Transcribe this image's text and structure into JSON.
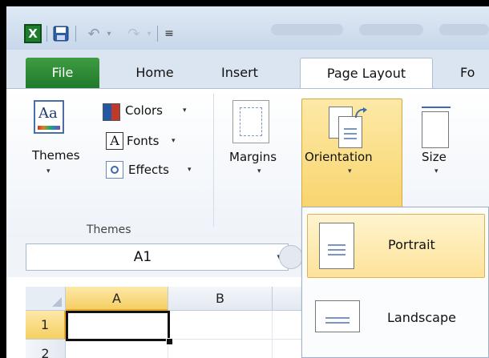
{
  "quick_access": {
    "app_logo": "X",
    "icons": [
      "excel-icon",
      "save-icon",
      "undo-icon",
      "redo-icon",
      "customize-icon"
    ],
    "undo_glyph": "↶",
    "redo_glyph": "↷",
    "dropdown_glyph": "▾",
    "customize_glyph": "≡"
  },
  "tabs": {
    "file": "File",
    "home": "Home",
    "insert": "Insert",
    "page_layout": "Page Layout",
    "formulas_partial": "Fo"
  },
  "ribbon": {
    "themes_group": {
      "themes_button": "Themes",
      "themes_icon_text": "Aa",
      "colors": "Colors",
      "fonts": "Fonts",
      "fonts_icon_text": "A",
      "effects": "Effects",
      "group_label": "Themes"
    },
    "page_setup": {
      "margins": "Margins",
      "orientation": "Orientation",
      "size": "Size"
    },
    "dropdown_glyph": "▾"
  },
  "formula_bar": {
    "name_box_value": "A1",
    "name_box_arrow": "▾"
  },
  "grid": {
    "columns": [
      "A",
      "B"
    ],
    "rows": [
      "1",
      "2"
    ],
    "selected_column": "A",
    "selected_row": "1"
  },
  "orientation_menu": {
    "items": [
      {
        "label": "Portrait",
        "selected": true
      },
      {
        "label": "Landscape",
        "selected": false
      }
    ]
  },
  "colors": {
    "accent_orange": "#f8d46c",
    "file_tab_green": "#1f7a2a",
    "ribbon_blue": "#dbe5f1"
  }
}
